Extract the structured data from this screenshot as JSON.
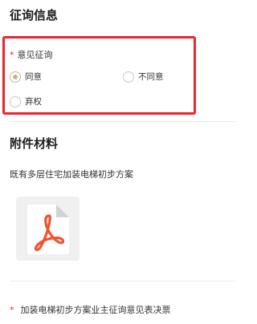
{
  "sections": {
    "consultation_title": "征询信息",
    "attachments_title": "附件材料"
  },
  "question1": {
    "required_mark": "*",
    "label": "意见征询",
    "options": [
      {
        "label": "同意",
        "checked": true
      },
      {
        "label": "不同意",
        "checked": false
      },
      {
        "label": "弃权",
        "checked": false
      }
    ]
  },
  "attachment": {
    "name": "既有多层住宅加装电梯初步方案",
    "icon": "pdf-file-icon",
    "accent": "#f1532d"
  },
  "question2": {
    "required_mark": "*",
    "label": "加装电梯初步方案业主征询意见表决票"
  },
  "colors": {
    "highlight": "#e8262c",
    "radio_checked": "#c7b68c",
    "required": "#e0302b"
  }
}
